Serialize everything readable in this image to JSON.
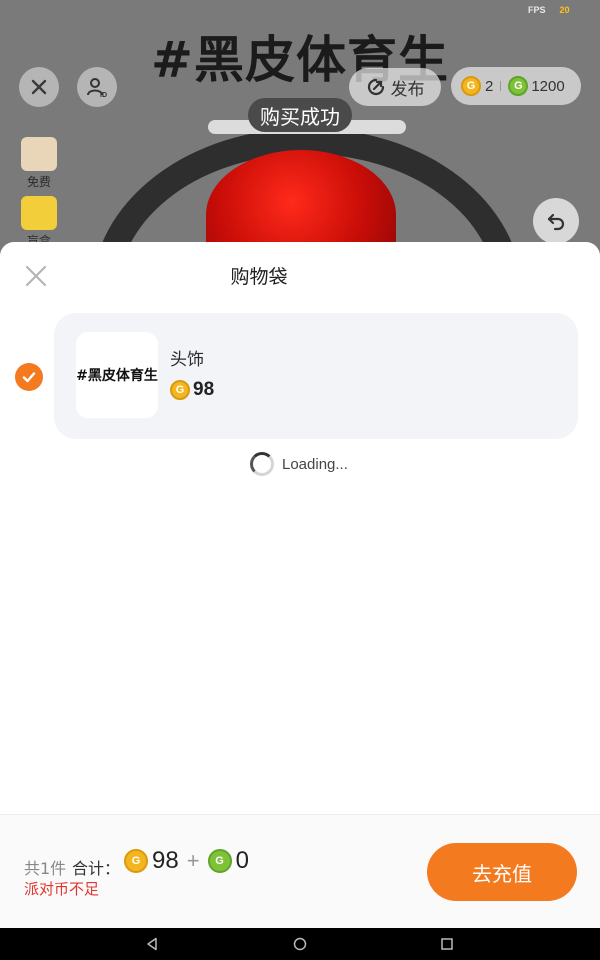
{
  "status": {
    "fps_label": "FPS",
    "fps_value": "20"
  },
  "scene": {
    "title": "#黑皮体育生",
    "publish_label": "发布",
    "coins": {
      "gold": "2",
      "green": "1200"
    },
    "toast": "购买成功",
    "side_items": [
      {
        "label": "免费"
      },
      {
        "label": "盲盒"
      }
    ]
  },
  "sheet": {
    "title": "购物袋",
    "items": [
      {
        "thumb_text": "#黑皮体育生",
        "name": "头饰",
        "price": "98",
        "checked": true
      }
    ],
    "loading_text": "Loading..."
  },
  "footer": {
    "count_label": "共1件",
    "total_label": "合计：",
    "gold_amount": "98",
    "plus": "+",
    "green_amount": "0",
    "warning": "派对币不足",
    "recharge_label": "去充值"
  },
  "colors": {
    "accent": "#f47a1f",
    "warning": "#e3342f",
    "gold_coin": "#f3b61f",
    "green_coin": "#7fc23a"
  },
  "icons": [
    "close-icon",
    "id-card-icon",
    "publish-icon",
    "gold-coin-icon",
    "green-coin-icon",
    "undo-icon",
    "check-icon",
    "back-icon",
    "home-icon",
    "recents-icon"
  ]
}
